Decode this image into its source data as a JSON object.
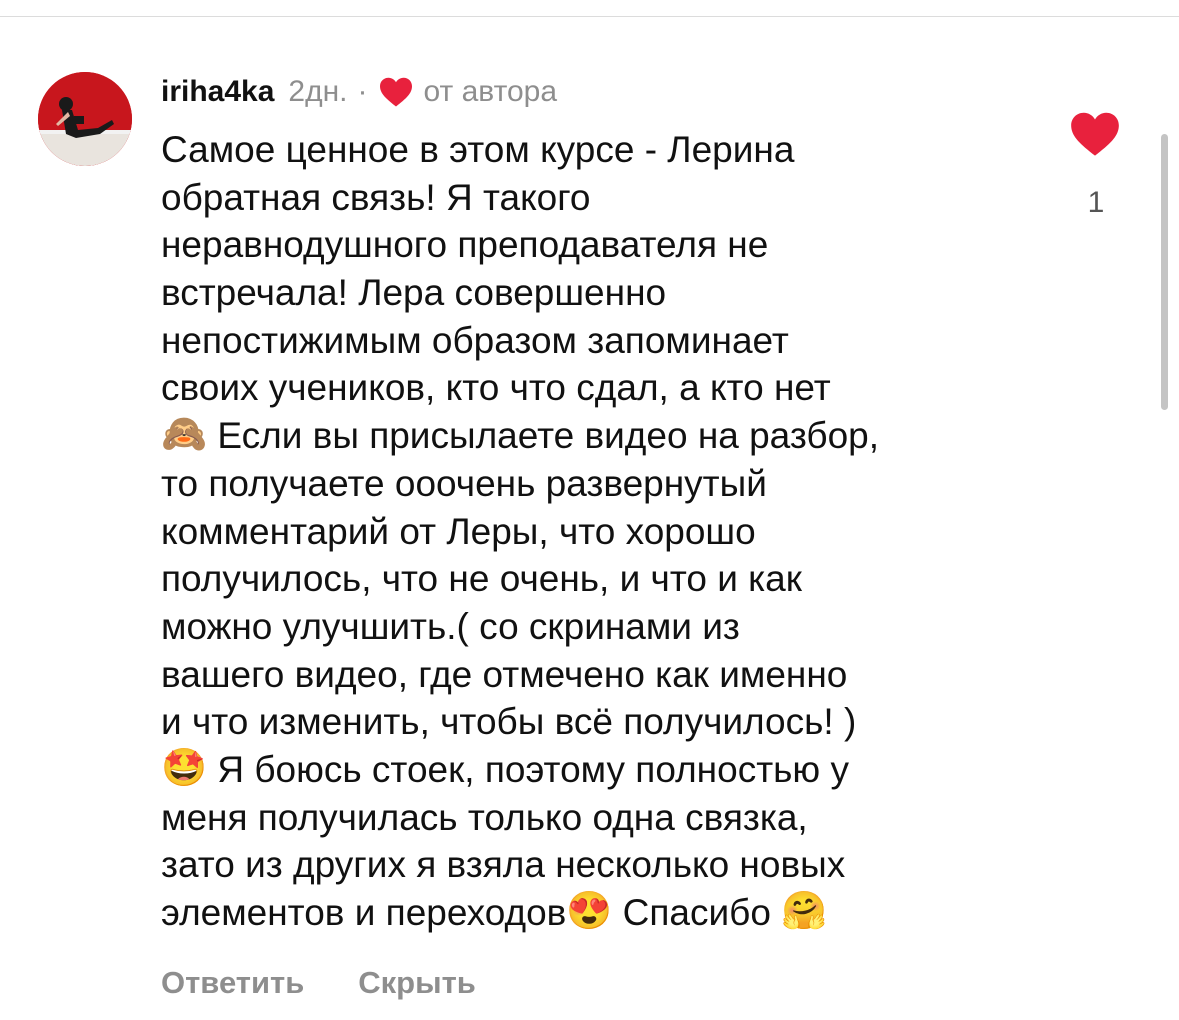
{
  "comment": {
    "username": "iriha4ka",
    "time": "2дн.",
    "separator": "·",
    "author_badge": "от автора",
    "author_heart_color": "#e8213d",
    "avatar_icon": "user-avatar-photo",
    "lines": [
      "Самое ценное в этом курсе - Лерина",
      "обратная связь! Я такого",
      "неравнодушного преподавателя не",
      "встречала! Лера совершенно",
      "непостижимым образом запоминает",
      "своих учеников, кто что сдал, а кто нет",
      "Если вы присылаете видео на разбор,",
      "то получаете ооочень развернутый",
      "комментарий от Леры, что хорошо",
      "получилось, что не очень, и что и как",
      "можно улучшить.( со скринами из",
      "вашего видео, где отмечено как именно",
      "и что изменить, чтобы всё получилось! )",
      "Я боюсь стоек, поэтому полностью у",
      "меня получилась только одна связка,",
      "зато из других я взяла несколько новых",
      "элементов и переходов",
      "Спасибо"
    ],
    "emojis": {
      "see_no_evil": "🙈",
      "star_struck": "🤩",
      "heart_eyes": "😍",
      "hugging": "🤗"
    },
    "like_icon": "heart-icon",
    "like_color": "#e8213d",
    "like_count": "1"
  },
  "actions": {
    "reply_label": "Ответить",
    "hide_label": "Скрыть"
  }
}
